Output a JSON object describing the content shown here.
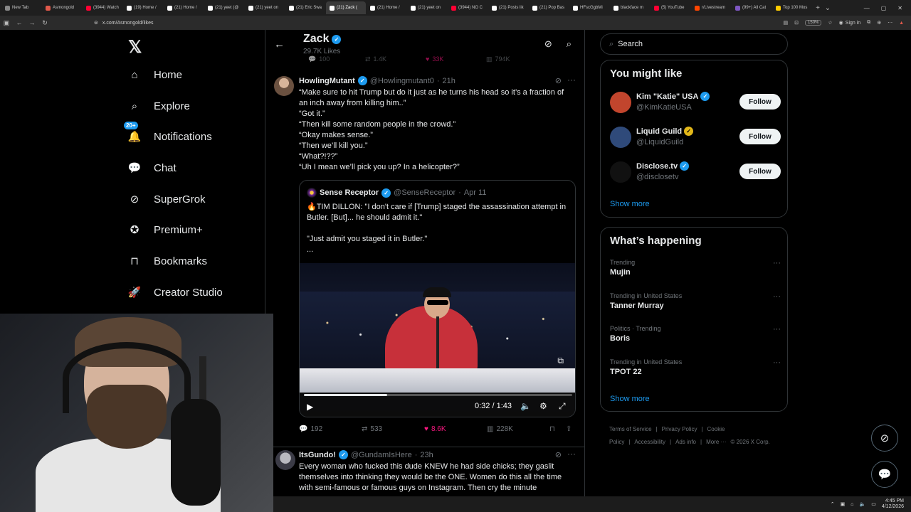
{
  "browser": {
    "tabs": [
      {
        "label": "New Tab",
        "color": "#888888"
      },
      {
        "label": "Asmongold",
        "color": "#e0594b"
      },
      {
        "label": "(3944) Watch",
        "color": "#ff0033"
      },
      {
        "label": "(19) Home /",
        "color": "#ffffff"
      },
      {
        "label": "(21) Home /",
        "color": "#ffffff"
      },
      {
        "label": "(21) yeet (@",
        "color": "#ffffff"
      },
      {
        "label": "(21) yeet on",
        "color": "#ffffff"
      },
      {
        "label": "(21) Eric Swa",
        "color": "#ffffff"
      },
      {
        "label": "(21) Zack (",
        "color": "#ffffff",
        "active": true
      },
      {
        "label": "(21) Home /",
        "color": "#ffffff"
      },
      {
        "label": "(21) yeet on",
        "color": "#ffffff"
      },
      {
        "label": "(3944) NO C",
        "color": "#ff0033"
      },
      {
        "label": "(21) Posts lik",
        "color": "#ffffff"
      },
      {
        "label": "(21) Pop Bas",
        "color": "#ffffff"
      },
      {
        "label": "HFscGgbMi",
        "color": "#ffffff"
      },
      {
        "label": "blackface m",
        "color": "#ffffff"
      },
      {
        "label": "(5) YouTube",
        "color": "#ff0033"
      },
      {
        "label": "r/Livestream",
        "color": "#ff4500"
      },
      {
        "label": "(99+) All Cat",
        "color": "#7e57c2"
      },
      {
        "label": "Top 100 Mos",
        "color": "#ffcc00"
      }
    ],
    "url": "x.com/Asmongold/likes",
    "zoom": "150%",
    "signin_label": "Sign in"
  },
  "nav": {
    "items": [
      {
        "label": "Home",
        "icon": "home-icon"
      },
      {
        "label": "Explore",
        "icon": "search-icon"
      },
      {
        "label": "Notifications",
        "icon": "bell-icon",
        "badge": "20+"
      },
      {
        "label": "Chat",
        "icon": "chat-icon"
      },
      {
        "label": "SuperGrok",
        "icon": "grok-icon"
      },
      {
        "label": "Premium+",
        "icon": "premium-icon"
      },
      {
        "label": "Bookmarks",
        "icon": "bookmark-icon"
      },
      {
        "label": "Creator Studio",
        "icon": "rocket-icon"
      }
    ]
  },
  "header": {
    "name": "Zack",
    "subtitle": "29.7K Likes",
    "prev_stats": {
      "replies": "100",
      "reposts": "1.4K",
      "likes": "33K",
      "views": "794K"
    }
  },
  "tweets": [
    {
      "name": "HowlingMutant",
      "handle": "@Howlingmutant0",
      "time": "21h",
      "text": "“Make sure to hit Trump but do it just as he turns his head so it’s a fraction of an inch away from killing him..”\n“Got it.”\n“Then kill some random people in the crowd.”\n“Okay makes sense.”\n“Then we’ll kill you.”\n“What?!??”\n“Uh I mean we’ll pick you up?  In a helicopter?”",
      "quote": {
        "name": "Sense Receptor",
        "handle": "@SenseReceptor",
        "date": "Apr 11",
        "text": "🔥TIM DILLON: \"I don't care if [Trump] staged the assassination attempt in Butler. [But]... he should admit it.\"\n\n\"Just admit you staged it in Butler.\"\n...",
        "video_time": "0:32 / 1:43",
        "video_progress": 0.31
      },
      "stats": {
        "replies": "192",
        "reposts": "533",
        "likes": "8.6K",
        "views": "228K"
      }
    },
    {
      "name": "ItsGundo!",
      "handle": "@GundamIsHere",
      "time": "23h",
      "text": "Every woman who fucked this dude KNEW he had side chicks; they gaslit themselves into thinking they would be the ONE. Women do this all the time with semi-famous or famous guys on Instagram. Then cry the minute"
    }
  ],
  "sidebar": {
    "search_placeholder": "Search",
    "you_might_like_title": "You might like",
    "suggestions": [
      {
        "name": "Kim \"Katie\" USA",
        "handle": "@KimKatieUSA",
        "badge": "blue",
        "avatar_color": "#c2452d"
      },
      {
        "name": "Liquid Guild",
        "handle": "@LiquidGuild",
        "badge": "gold",
        "avatar_color": "#2f4a7a"
      },
      {
        "name": "Disclose.tv",
        "handle": "@disclosetv",
        "badge": "blue",
        "avatar_color": "#111111"
      }
    ],
    "follow_label": "Follow",
    "show_more_label": "Show more",
    "happening_title": "What’s happening",
    "trends": [
      {
        "context": "Trending",
        "title": "Mujin"
      },
      {
        "context": "Trending in United States",
        "title": "Tanner Murray"
      },
      {
        "context": "Politics · Trending",
        "title": "Boris"
      },
      {
        "context": "Trending in United States",
        "title": "TPOT 22"
      }
    ],
    "footer": [
      "Terms of Service",
      "|",
      "Privacy Policy",
      "|",
      "Cookie Policy",
      "|",
      "Accessibility",
      "|",
      "Ads info",
      "|",
      "More ···",
      "© 2026 X Corp."
    ]
  },
  "taskbar": {
    "time": "4:45 PM",
    "date": "4/12/2026"
  },
  "colors": {
    "accent": "#1d9bf0",
    "like": "#f91880",
    "gold_badge": "#e2b719"
  }
}
